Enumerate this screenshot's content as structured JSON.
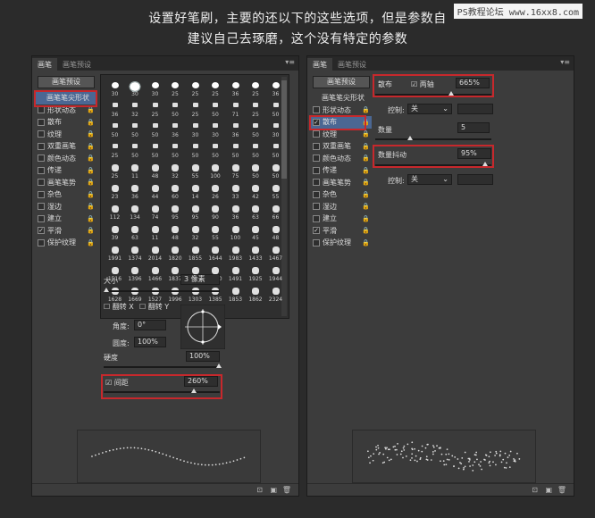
{
  "caption_line1": "设置好笔刷，主要的还以下的这些选项，但是参数自",
  "caption_line2": "建议自己去琢磨，这个没有特定的参数",
  "watermark": "PS教程论坛 www.16xx8.com",
  "left_panel": {
    "tabs": [
      "画笔",
      "画笔预设"
    ],
    "preset_button": "画笔预设",
    "sidebar": [
      {
        "label": "画笔笔尖形状",
        "checkbox": false,
        "selected": true
      },
      {
        "label": "形状动态",
        "checkbox": true,
        "checked": false
      },
      {
        "label": "散布",
        "checkbox": true,
        "checked": false
      },
      {
        "label": "纹理",
        "checkbox": true,
        "checked": false
      },
      {
        "label": "双重画笔",
        "checkbox": true,
        "checked": false
      },
      {
        "label": "颜色动态",
        "checkbox": true,
        "checked": false
      },
      {
        "label": "传递",
        "checkbox": true,
        "checked": false
      },
      {
        "label": "画笔笔势",
        "checkbox": true,
        "checked": false
      },
      {
        "label": "杂色",
        "checkbox": true,
        "checked": false
      },
      {
        "label": "湿边",
        "checkbox": true,
        "checked": false
      },
      {
        "label": "建立",
        "checkbox": true,
        "checked": false
      },
      {
        "label": "平滑",
        "checkbox": true,
        "checked": true
      },
      {
        "label": "保护纹理",
        "checkbox": true,
        "checked": false
      }
    ],
    "brush_numbers": [
      [
        "30",
        "30",
        "30",
        "25",
        "25",
        "25",
        "36",
        "25",
        "36"
      ],
      [
        "36",
        "32",
        "25",
        "50",
        "25",
        "50",
        "71",
        "25",
        "50"
      ],
      [
        "50",
        "50",
        "50",
        "36",
        "30",
        "30",
        "36",
        "50",
        "30"
      ],
      [
        "25",
        "50",
        "50",
        "50",
        "50",
        "50",
        "50",
        "50",
        "50"
      ],
      [
        "25",
        "11",
        "48",
        "32",
        "55",
        "100",
        "75",
        "50",
        "50"
      ],
      [
        "23",
        "36",
        "44",
        "60",
        "14",
        "26",
        "33",
        "42",
        "55"
      ],
      [
        "112",
        "134",
        "74",
        "95",
        "95",
        "90",
        "36",
        "63",
        "66"
      ],
      [
        "39",
        "63",
        "11",
        "48",
        "32",
        "55",
        "100",
        "45",
        "48"
      ],
      [
        "1991",
        "1374",
        "2014",
        "1820",
        "1855",
        "1644",
        "1983",
        "1433",
        "1467"
      ],
      [
        "1516",
        "1396",
        "1466",
        "1837",
        "1662",
        "1960",
        "1491",
        "1925",
        "1944"
      ],
      [
        "1628",
        "1669",
        "1527",
        "1996",
        "1303",
        "1385",
        "1853",
        "1862",
        "2324"
      ]
    ],
    "size_label": "大小",
    "size_value": "3 像素",
    "flip_x_label": "翻转 X",
    "flip_y_label": "翻转 Y",
    "angle_label": "角度:",
    "angle_value": "0°",
    "roundness_label": "圆度:",
    "roundness_value": "100%",
    "hardness_label": "硬度",
    "hardness_value": "100%",
    "spacing_label": "间距",
    "spacing_value": "260%",
    "spacing_checked": true
  },
  "right_panel": {
    "tabs": [
      "画笔",
      "画笔预设"
    ],
    "preset_button": "画笔预设",
    "sidebar": [
      {
        "label": "画笔笔尖形状",
        "checkbox": false,
        "selected": false
      },
      {
        "label": "形状动态",
        "checkbox": true,
        "checked": false
      },
      {
        "label": "散布",
        "checkbox": true,
        "checked": true,
        "selected": true
      },
      {
        "label": "纹理",
        "checkbox": true,
        "checked": false
      },
      {
        "label": "双重画笔",
        "checkbox": true,
        "checked": false
      },
      {
        "label": "颜色动态",
        "checkbox": true,
        "checked": false
      },
      {
        "label": "传递",
        "checkbox": true,
        "checked": false
      },
      {
        "label": "画笔笔势",
        "checkbox": true,
        "checked": false
      },
      {
        "label": "杂色",
        "checkbox": true,
        "checked": false
      },
      {
        "label": "湿边",
        "checkbox": true,
        "checked": false
      },
      {
        "label": "建立",
        "checkbox": true,
        "checked": false
      },
      {
        "label": "平滑",
        "checkbox": true,
        "checked": true
      },
      {
        "label": "保护纹理",
        "checkbox": true,
        "checked": false
      }
    ],
    "scatter_label": "散布",
    "both_axes_label": "两轴",
    "both_axes_checked": true,
    "scatter_value": "665%",
    "control_label": "控制:",
    "control_value": "关",
    "count_label": "数量",
    "count_value": "5",
    "count_jitter_label": "数量抖动",
    "count_jitter_value": "95%",
    "control2_label": "控制:",
    "control2_value": "关"
  },
  "colors": {
    "highlight": "#c7282c",
    "selected": "#4b6793",
    "panel": "#3c3c3c",
    "background": "#2b2b2b"
  }
}
